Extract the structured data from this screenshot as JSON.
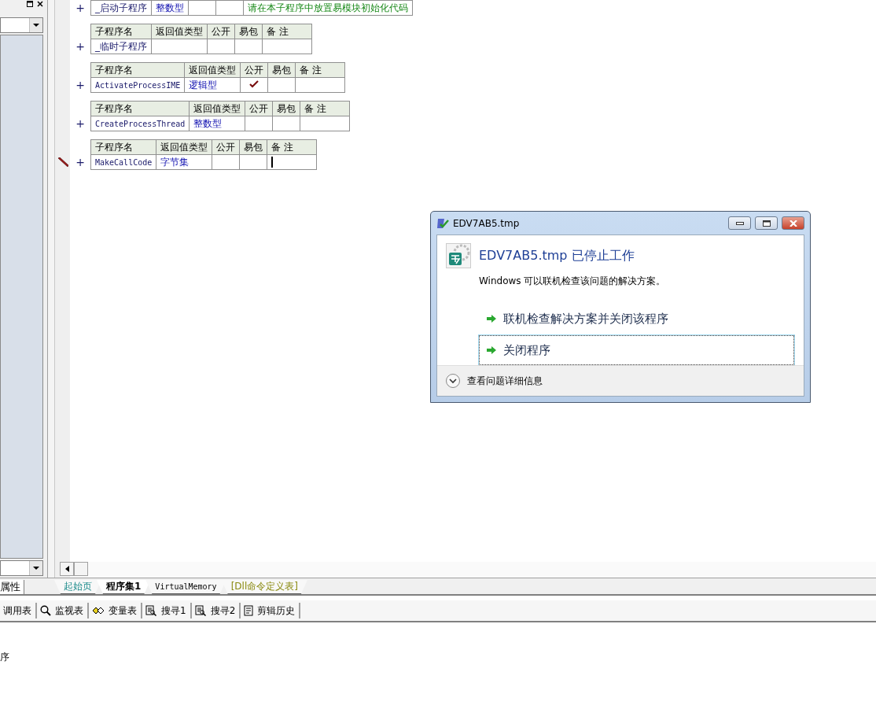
{
  "left_panel": {
    "tab": "属性"
  },
  "subroutines": [
    {
      "expand_symbol": "+",
      "name": "_启动子程序",
      "return_type": "整数型",
      "public": false,
      "note": "请在本子程序中放置易模块初始化代码",
      "editing": false
    },
    {
      "expand_symbol": "+",
      "columns": [
        "子程序名",
        "返回值类型",
        "公开",
        "易包",
        "备 注"
      ],
      "name": "_临时子程序",
      "public": false,
      "editing": false
    },
    {
      "expand_symbol": "+",
      "columns": [
        "子程序名",
        "返回值类型",
        "公开",
        "易包",
        "备 注"
      ],
      "name": "ActivateProcessIME",
      "return_type": "逻辑型",
      "public": true,
      "editing": false
    },
    {
      "expand_symbol": "+",
      "columns": [
        "子程序名",
        "返回值类型",
        "公开",
        "易包",
        "备 注"
      ],
      "name": "CreateProcessThread",
      "return_type": "整数型",
      "public": false,
      "editing": false
    },
    {
      "expand_symbol": "+",
      "columns": [
        "子程序名",
        "返回值类型",
        "公开",
        "易包",
        "备 注"
      ],
      "name": "MakeCallCode",
      "return_type": "字节集",
      "public": false,
      "editing": true
    }
  ],
  "tabs": [
    {
      "label": "起始页",
      "selected": false,
      "kind": "start"
    },
    {
      "label": "程序集1",
      "selected": true,
      "kind": "module"
    },
    {
      "label": "VirtualMemory",
      "selected": false,
      "kind": "class"
    },
    {
      "label": "[Dll命令定义表]",
      "selected": false,
      "kind": "dll"
    }
  ],
  "toolbar": [
    "调用表",
    "监视表",
    "变量表",
    "搜寻1",
    "搜寻2",
    "剪辑历史"
  ],
  "output": "序",
  "dialog": {
    "title": "EDV7AB5.tmp",
    "heading": "EDV7AB5.tmp 已停止工作",
    "message": "Windows 可以联机检查该问题的解决方案。",
    "options": [
      {
        "label": "联机检查解决方案并关闭该程序",
        "focused": false
      },
      {
        "label": "关闭程序",
        "focused": true
      }
    ],
    "details": "查看问题详细信息"
  }
}
